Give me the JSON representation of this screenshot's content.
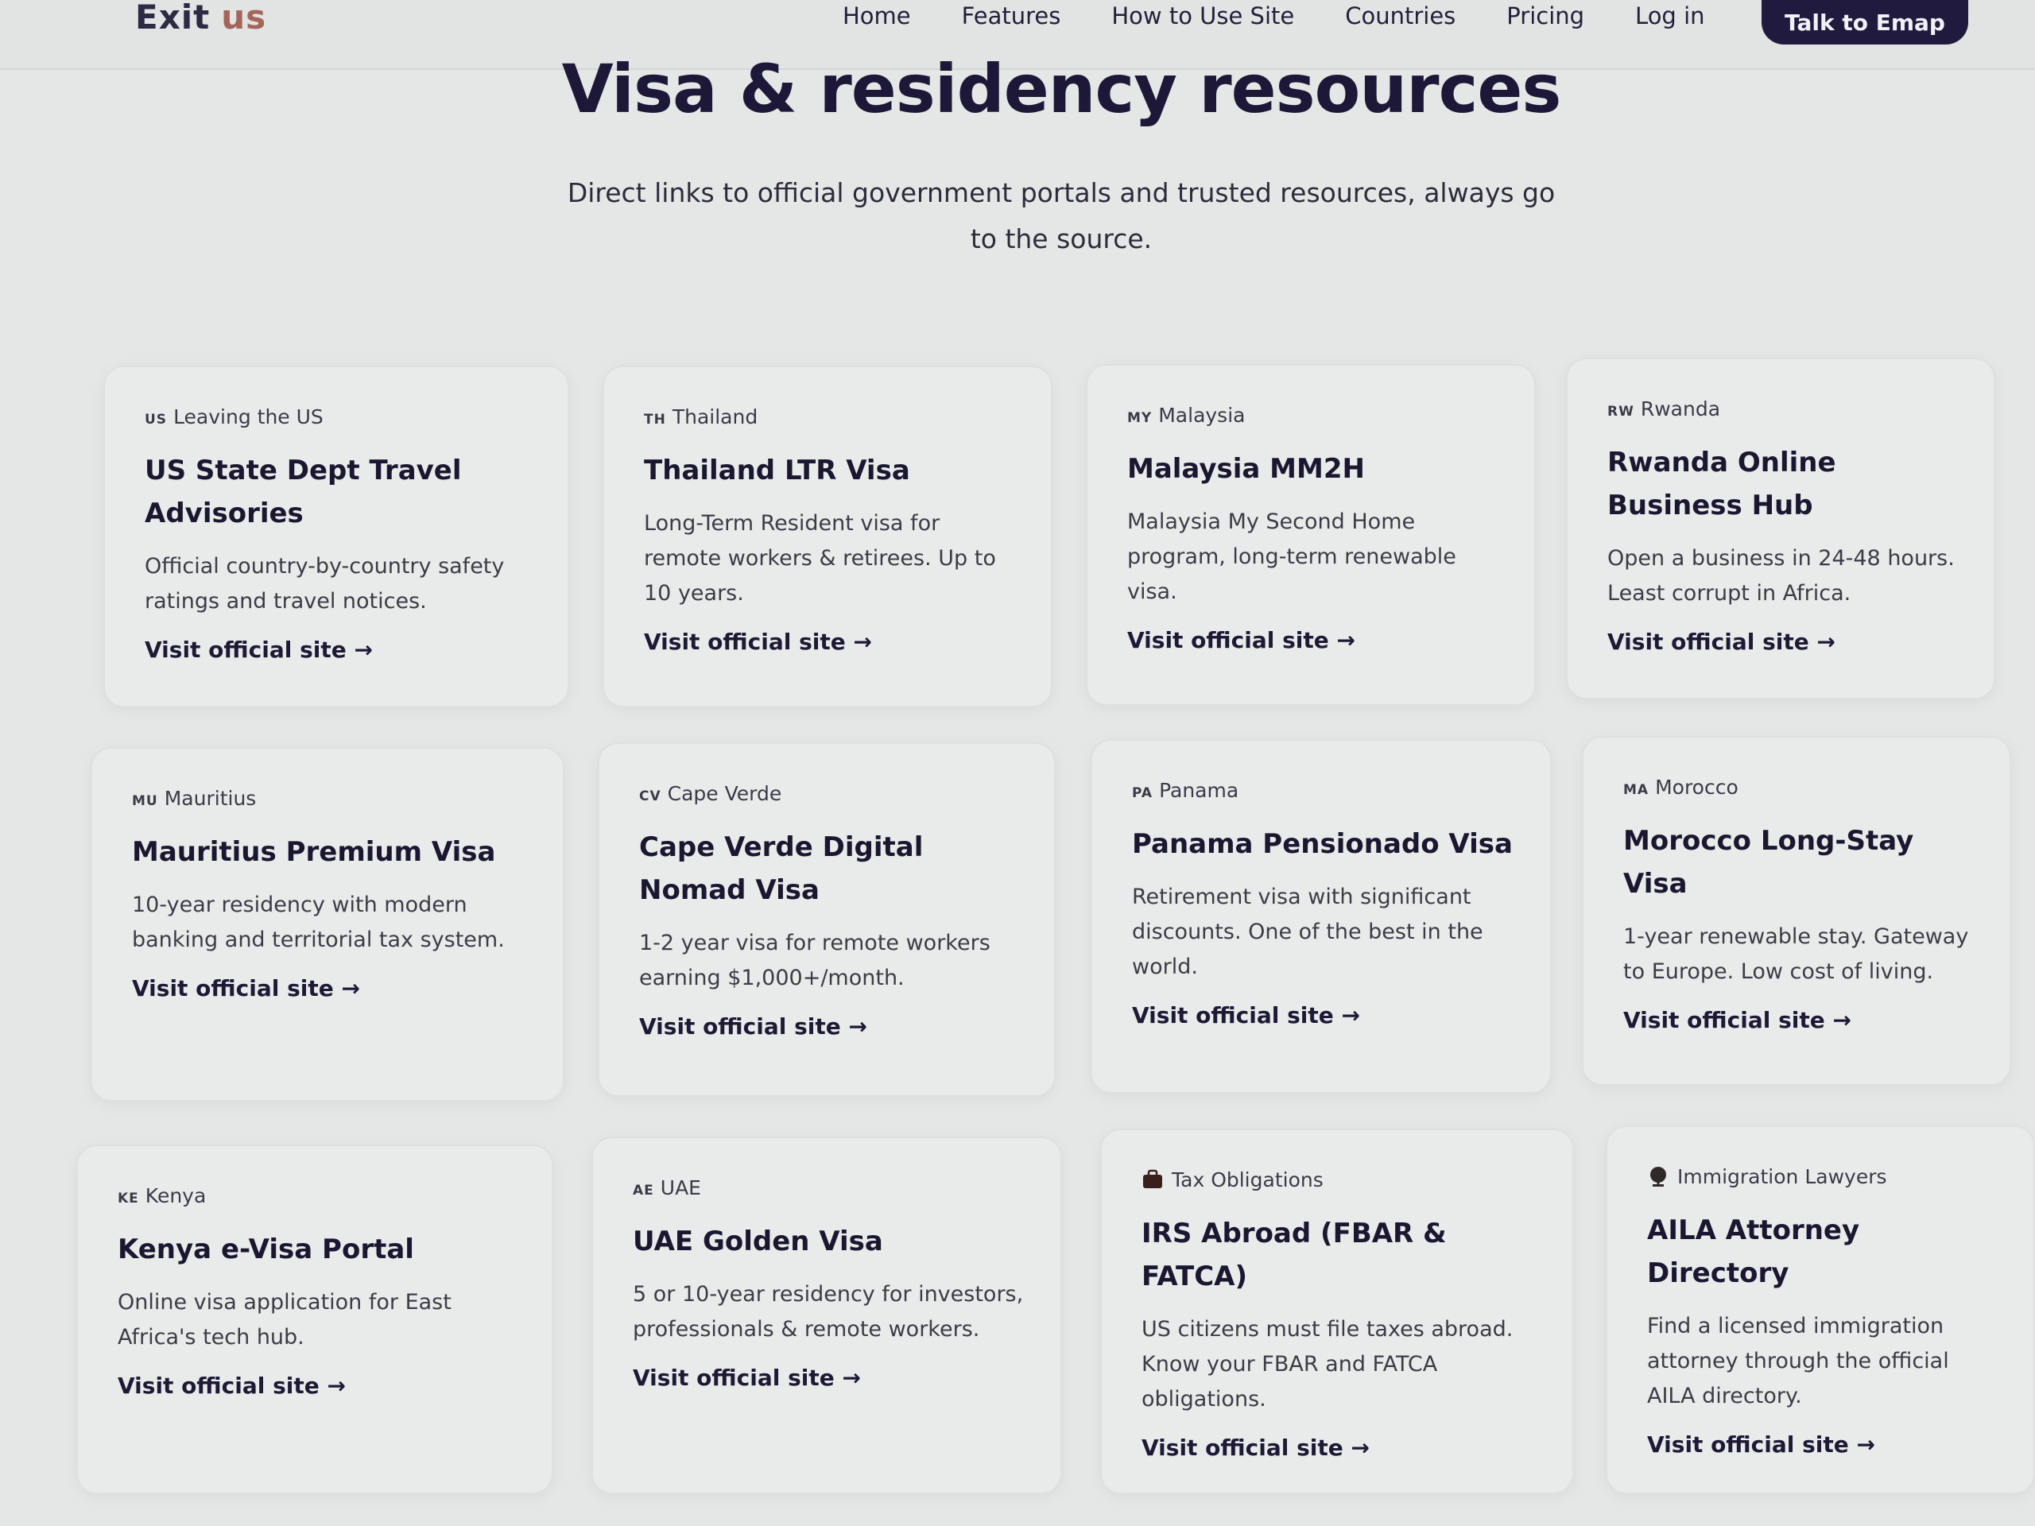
{
  "nav": {
    "logo_part1": "Exit",
    "logo_part2": "us",
    "links": [
      "Home",
      "Features",
      "How to Use Site",
      "Countries",
      "Pricing",
      "Log in"
    ],
    "cta_label": "Talk to Emap"
  },
  "hero": {
    "title": "Visa & residency resources",
    "subtitle": "Direct links to official government portals and trusted resources, always go to the source."
  },
  "cards": [
    {
      "code": "US",
      "tag": "Leaving the US",
      "title": "US State Dept Travel Advisories",
      "desc": "Official country-by-country safety ratings and travel notices.",
      "link": "Visit official site →"
    },
    {
      "code": "TH",
      "tag": "Thailand",
      "title": "Thailand LTR Visa",
      "desc": "Long-Term Resident visa for remote workers & retirees. Up to 10 years.",
      "link": "Visit official site →"
    },
    {
      "code": "MY",
      "tag": "Malaysia",
      "title": "Malaysia MM2H",
      "desc": "Malaysia My Second Home program, long-term renewable visa.",
      "link": "Visit official site →"
    },
    {
      "code": "RW",
      "tag": "Rwanda",
      "title": "Rwanda Online Business Hub",
      "desc": "Open a business in 24-48 hours. Least corrupt in Africa.",
      "link": "Visit official site →"
    },
    {
      "code": "MU",
      "tag": "Mauritius",
      "title": "Mauritius Premium Visa",
      "desc": "10-year residency with modern banking and territorial tax system.",
      "link": "Visit official site →"
    },
    {
      "code": "CV",
      "tag": "Cape Verde",
      "title": "Cape Verde Digital Nomad Visa",
      "desc": "1-2 year visa for remote workers earning $1,000+/month.",
      "link": "Visit official site →"
    },
    {
      "code": "PA",
      "tag": "Panama",
      "title": "Panama Pensionado Visa",
      "desc": "Retirement visa with significant discounts. One of the best in the world.",
      "link": "Visit official site →"
    },
    {
      "code": "MA",
      "tag": "Morocco",
      "title": "Morocco Long-Stay Visa",
      "desc": "1-year renewable stay. Gateway to Europe. Low cost of living.",
      "link": "Visit official site →"
    },
    {
      "code": "KE",
      "tag": "Kenya",
      "title": "Kenya e-Visa Portal",
      "desc": "Online visa application for East Africa's tech hub.",
      "link": "Visit official site →"
    },
    {
      "code": "AE",
      "tag": "UAE",
      "title": "UAE Golden Visa",
      "desc": "5 or 10-year residency for investors, professionals & remote workers.",
      "link": "Visit official site →"
    },
    {
      "icon": "briefcase-icon",
      "tag": "Tax Obligations",
      "title": "IRS Abroad (FBAR & FATCA)",
      "desc": "US citizens must file taxes abroad. Know your FBAR and FATCA obligations.",
      "link": "Visit official site →"
    },
    {
      "icon": "scales-icon",
      "tag": "Immigration Lawyers",
      "title": "AILA Attorney Directory",
      "desc": "Find a licensed immigration attorney through the official AILA directory.",
      "link": "Visit official site →"
    }
  ]
}
